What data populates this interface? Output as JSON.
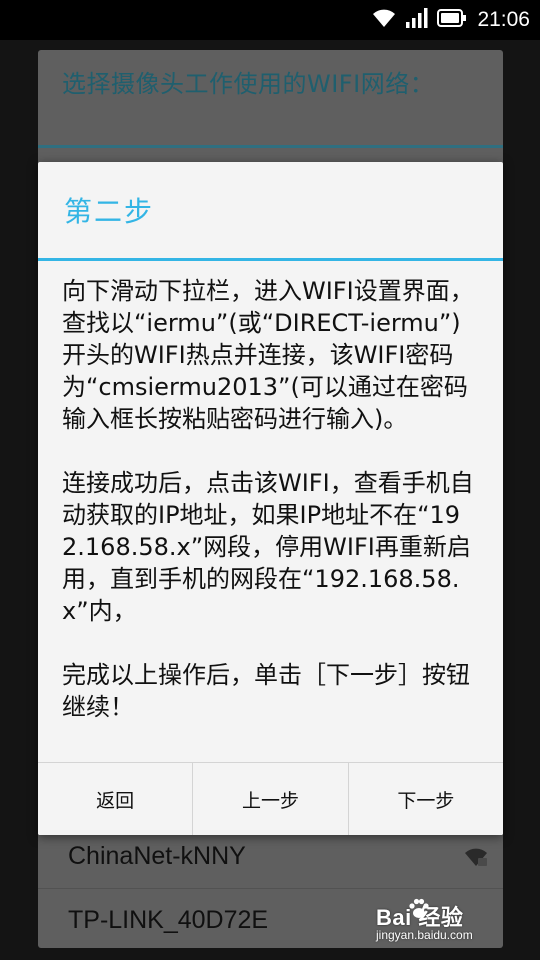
{
  "status_bar": {
    "time": "21:06"
  },
  "background_list": {
    "title": "选择摄像头工作使用的WIFI网络：",
    "networks": [
      {
        "name": "ChinaNet-kNNY",
        "icon": "wifi-locked-icon"
      },
      {
        "name": "TP-LINK_40D72E",
        "icon": "wifi-icon"
      }
    ]
  },
  "dialog": {
    "title": "第二步",
    "paragraphs": [
      "向下滑动下拉栏，进入WIFI设置界面，查找以“iermu”(或“DIRECT-iermu”)开头的WIFI热点并连接，该WIFI密码为“cmsiermu2013”(可以通过在密码输入框长按粘贴密码进行输入)。",
      "连接成功后，点击该WIFI，查看手机自动获取的IP地址，如果IP地址不在“192.168.58.x”网段，停用WIFI再重新启用，直到手机的网段在“192.168.58.x”内，",
      "完成以上操作后，单击［下一步］按钮继续！"
    ],
    "buttons": {
      "back": "返回",
      "previous": "上一步",
      "next": "下一步"
    }
  },
  "watermark": {
    "logo_text": "Bai  经验",
    "sub_text": "jingyan.baidu.com"
  },
  "colors": {
    "accent": "#33b5e5",
    "dialog_bg": "#f4f4f4",
    "dim_bg": "#5f5f5f"
  }
}
